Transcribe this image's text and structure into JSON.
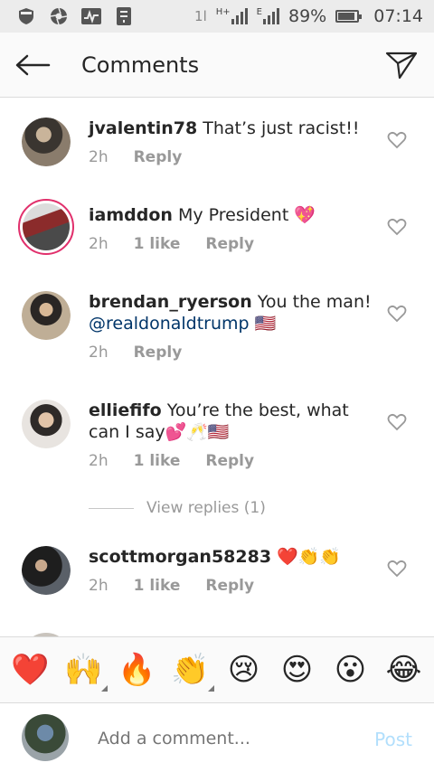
{
  "status_bar": {
    "battery": "89%",
    "battery_level": 0.89,
    "time": "07:14",
    "network_icons": [
      "shield-icon",
      "camera-aperture-icon",
      "activity-icon",
      "clipboard-icon"
    ],
    "data_arrows": "1l",
    "network_h": "H+",
    "network_e": "E"
  },
  "header": {
    "title": "Comments",
    "back_icon": "arrow-left-icon",
    "share_icon": "paper-plane-icon"
  },
  "comments": [
    {
      "username": "jvalentin78",
      "text": "That’s just racist!!",
      "time": "2h",
      "likes": "",
      "reply": "Reply"
    },
    {
      "username": "iamddon",
      "text": "My President 💖",
      "time": "2h",
      "likes": "1 like",
      "reply": "Reply"
    },
    {
      "username": "brendan_ryerson",
      "text": "You the man!",
      "mention": "@realdonaldtrump",
      "flag": "🇺🇸",
      "time": "2h",
      "likes": "",
      "reply": "Reply"
    },
    {
      "username": "elliefifo",
      "text": "You’re the best, what can I say💕🥂🇺🇸",
      "time": "2h",
      "likes": "1 like",
      "reply": "Reply",
      "view_replies": "View replies (1)"
    },
    {
      "username": "scottmorgan58283",
      "text": "❤️👏👏",
      "time": "2h",
      "likes": "1 like",
      "reply": "Reply"
    }
  ],
  "emoji_bar": [
    "❤️",
    "🙌",
    "🔥",
    "👏",
    "😢",
    "😍",
    "😮",
    "😂"
  ],
  "composer": {
    "placeholder": "Add a comment...",
    "post_label": "Post"
  },
  "colors": {
    "post_disabled": "#b2dffc",
    "mention": "#003569",
    "meta": "#999999",
    "story_ring": "#e1306c"
  }
}
